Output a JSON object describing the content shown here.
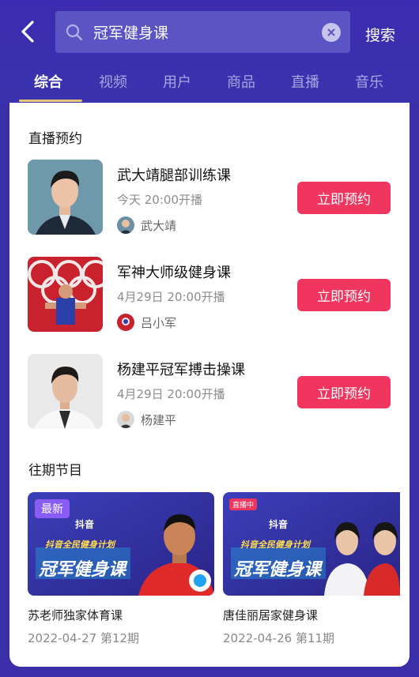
{
  "header": {
    "search_query": "冠军健身课",
    "search_action": "搜索"
  },
  "tabs": [
    {
      "label": "综合"
    },
    {
      "label": "视频"
    },
    {
      "label": "用户"
    },
    {
      "label": "商品"
    },
    {
      "label": "直播"
    },
    {
      "label": "音乐"
    }
  ],
  "live_section": {
    "title": "直播预约",
    "items": [
      {
        "title": "武大靖腿部训练课",
        "time": "今天 20:00开播",
        "author": "武大靖",
        "button": "立即预约"
      },
      {
        "title": "军神大师级健身课",
        "time": "4月29日 20:00开播",
        "author": "吕小军",
        "button": "立即预约"
      },
      {
        "title": "杨建平冠军搏击操课",
        "time": "4月29日 20:00开播",
        "author": "杨建平",
        "button": "立即预约"
      }
    ]
  },
  "past_section": {
    "title": "往期节目",
    "items": [
      {
        "title": "苏老师独家体育课",
        "date": "2022-04-27 第12期",
        "badge": "最新",
        "poster_brand": "抖音",
        "poster_slogan": "冠军健身课",
        "poster_plan": "抖音全民健身计划"
      },
      {
        "title": "唐佳丽居家健身课",
        "date": "2022-04-26 第11期",
        "badge": "",
        "poster_brand": "抖音",
        "poster_slogan": "冠军健身课",
        "poster_plan": "抖音全民健身计划",
        "live_tag": "直播中"
      }
    ]
  },
  "colors": {
    "header_bg": "#3a2fa8",
    "accent": "#f0355e",
    "tab_underline": "#e9c67a"
  }
}
